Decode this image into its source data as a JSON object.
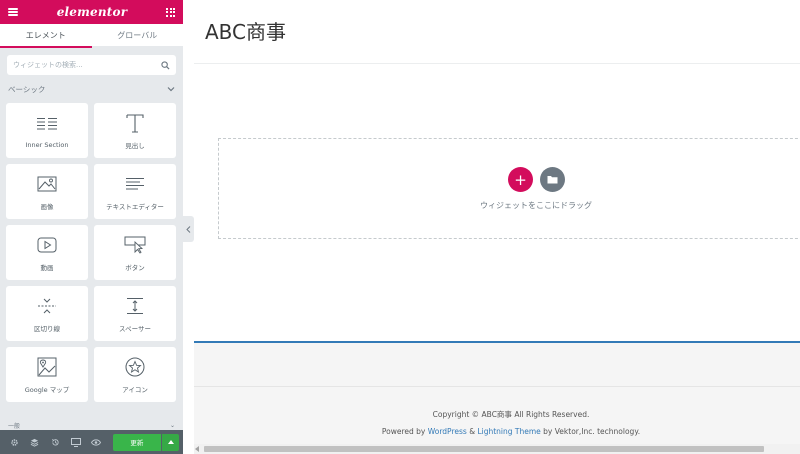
{
  "panel": {
    "logo": "elementor",
    "tabs": [
      {
        "label": "エレメント"
      },
      {
        "label": "グローバル"
      }
    ],
    "search": {
      "placeholder": "ウィジェットの検索..."
    },
    "category": "ベーシック",
    "widgets": [
      {
        "label": "Inner Section",
        "icon": "inner-section-icon"
      },
      {
        "label": "見出し",
        "icon": "heading-icon"
      },
      {
        "label": "画像",
        "icon": "image-icon"
      },
      {
        "label": "テキストエディター",
        "icon": "text-editor-icon"
      },
      {
        "label": "動画",
        "icon": "video-icon"
      },
      {
        "label": "ボタン",
        "icon": "button-icon"
      },
      {
        "label": "区切り線",
        "icon": "divider-icon"
      },
      {
        "label": "スペーサー",
        "icon": "spacer-icon"
      },
      {
        "label": "Google マップ",
        "icon": "google-maps-icon"
      },
      {
        "label": "アイコン",
        "icon": "star-icon"
      }
    ],
    "category2": "一般",
    "footer": {
      "update_label": "更新"
    }
  },
  "preview": {
    "site_title": "ABC商事",
    "drop_text": "ウィジェットをここにドラッグ",
    "copyright": "Copyright © ABC商事 All Rights Reserved.",
    "powered_prefix": "Powered by",
    "wordpress": "WordPress",
    "amp": "&",
    "theme": "Lightning Theme",
    "powered_suffix": "by Vektor,Inc. technology."
  },
  "colors": {
    "brand": "#d30c5c",
    "panel_bg": "#e6e9ec",
    "footer_bg": "#556068",
    "update_green": "#39b54a",
    "link_blue": "#337ab7"
  }
}
